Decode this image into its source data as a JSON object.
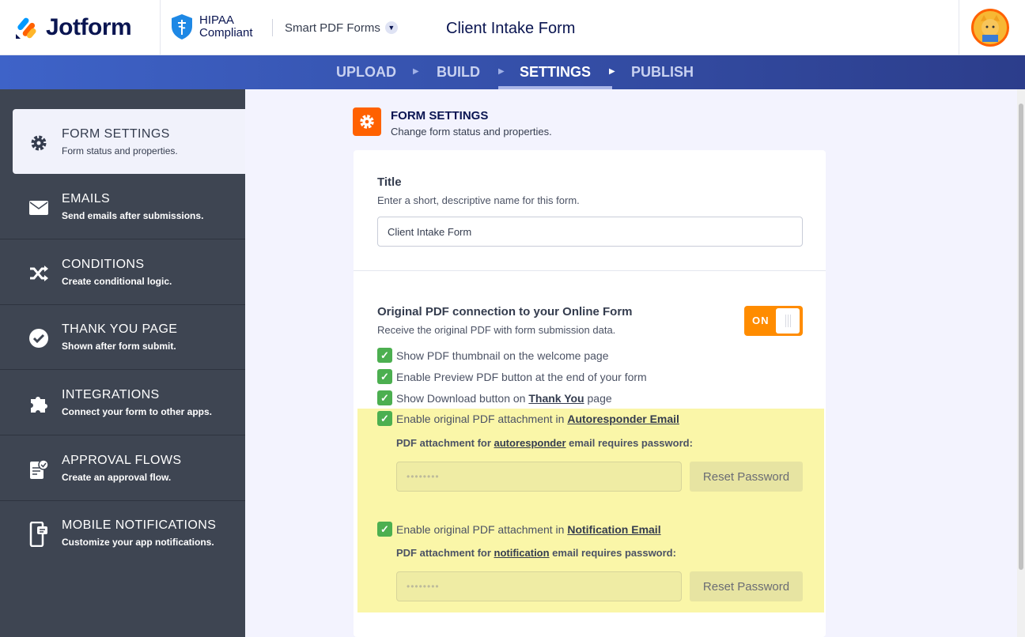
{
  "header": {
    "brand": "Jotform",
    "hipaa_line1": "HIPAA",
    "hipaa_line2": "Compliant",
    "product": "Smart PDF Forms",
    "form_title": "Client Intake Form"
  },
  "nav": {
    "steps": [
      {
        "label": "UPLOAD"
      },
      {
        "label": "BUILD"
      },
      {
        "label": "SETTINGS",
        "active": true
      },
      {
        "label": "PUBLISH"
      }
    ]
  },
  "sidebar": {
    "items": [
      {
        "title": "FORM SETTINGS",
        "sub": "Form status and properties.",
        "icon": "gear-icon",
        "active": true
      },
      {
        "title": "EMAILS",
        "sub": "Send emails after submissions.",
        "icon": "envelope-icon"
      },
      {
        "title": "CONDITIONS",
        "sub": "Create conditional logic.",
        "icon": "shuffle-icon"
      },
      {
        "title": "THANK YOU PAGE",
        "sub": "Shown after form submit.",
        "icon": "check-circle-icon"
      },
      {
        "title": "INTEGRATIONS",
        "sub": "Connect your form to other apps.",
        "icon": "puzzle-icon"
      },
      {
        "title": "APPROVAL FLOWS",
        "sub": "Create an approval flow.",
        "icon": "approval-icon"
      },
      {
        "title": "MOBILE NOTIFICATIONS",
        "sub": "Customize your app notifications.",
        "icon": "mobile-icon"
      }
    ]
  },
  "section": {
    "title": "FORM SETTINGS",
    "sub": "Change form status and properties."
  },
  "title_field": {
    "label": "Title",
    "desc": "Enter a short, descriptive name for this form.",
    "value": "Client Intake Form"
  },
  "pdf": {
    "label": "Original PDF connection to your Online Form",
    "desc": "Receive the original PDF with form submission data.",
    "toggle": "ON",
    "cb1": "Show PDF thumbnail on the welcome page",
    "cb2": "Enable Preview PDF button at the end of your form",
    "cb3_pre": "Show Download button on ",
    "cb3_link": "Thank You",
    "cb3_post": " page",
    "cb4_pre": "Enable original PDF attachment in ",
    "cb4_link": "Autoresponder Email",
    "auto_pre": "PDF attachment for ",
    "auto_link": "autoresponder",
    "auto_post": " email requires password:",
    "cb5_pre": "Enable original PDF attachment in ",
    "cb5_link": "Notification Email",
    "notif_pre": "PDF attachment for ",
    "notif_link": "notification",
    "notif_post": " email requires password:",
    "password_mask": "••••••••",
    "reset_label": "Reset Password"
  },
  "colors": {
    "accent": "#ff6100",
    "toggle": "#ff8c00",
    "check": "#4caf50",
    "highlight": "#faf6a8",
    "sidebar": "#3e4552"
  }
}
